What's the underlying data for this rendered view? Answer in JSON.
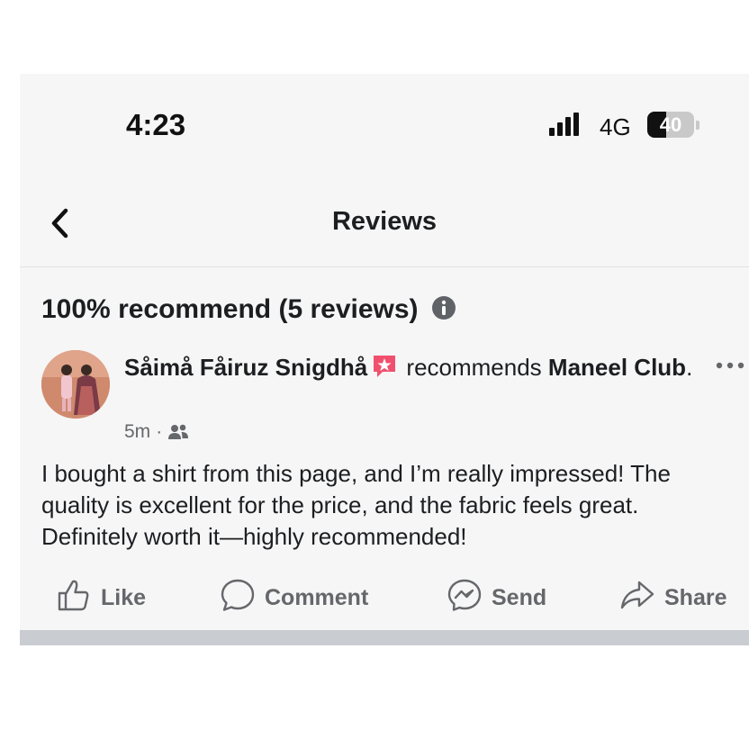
{
  "status_bar": {
    "time": "4:23",
    "network": "4G",
    "battery_level": "40"
  },
  "nav": {
    "title": "Reviews"
  },
  "summary": {
    "text": "100% recommend (5 reviews)"
  },
  "post": {
    "author": "Såimå Fåiruz Snigdhå",
    "verb": "recommends",
    "page_name": "Maneel Club",
    "page_suffix": ".",
    "time": "5m",
    "separator": "·",
    "body": "I bought a shirt from this page, and I’m really impressed! The quality is excellent for the price, and the fabric feels great. Definitely worth it—highly recommended!"
  },
  "actions": {
    "like": "Like",
    "comment": "Comment",
    "send": "Send",
    "share": "Share"
  },
  "icons": {
    "back": "chevron-left-icon",
    "info": "info-icon",
    "badge": "star-badge-icon",
    "more": "more-horizontal-icon",
    "audience": "friends-icon",
    "like": "thumbs-up-icon",
    "comment": "comment-bubble-icon",
    "send": "messenger-icon",
    "share": "share-arrow-icon"
  },
  "colors": {
    "text_primary": "#1c1e21",
    "text_secondary": "#65676b",
    "badge": "#f0506e",
    "screen_bg": "#f6f6f6",
    "separator": "#c9ccd1"
  }
}
